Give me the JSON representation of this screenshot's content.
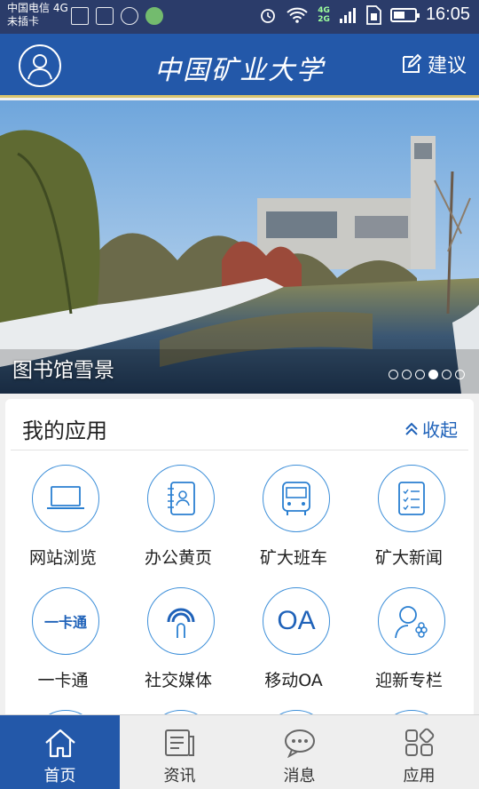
{
  "status_bar": {
    "carrier_line1": "中国电信 4G",
    "carrier_line2": "未插卡",
    "net_4g": "4G",
    "net_2g": "2G",
    "time": "16:05",
    "battery_level": 0.45
  },
  "header": {
    "logo_text": "中国矿业大学",
    "suggest_label": "建议"
  },
  "banner": {
    "caption": "图书馆雪景",
    "slide_count": 6,
    "active_slide": 4
  },
  "apps": {
    "title": "我的应用",
    "collapse_label": "收起",
    "items": [
      {
        "label": "网站浏览",
        "icon": "laptop-icon"
      },
      {
        "label": "办公黄页",
        "icon": "contact-book-icon"
      },
      {
        "label": "矿大班车",
        "icon": "bus-icon"
      },
      {
        "label": "矿大新闻",
        "icon": "news-list-icon"
      },
      {
        "label": "一卡通",
        "icon": "card-icon",
        "icon_text": "一卡通"
      },
      {
        "label": "社交媒体",
        "icon": "broadcast-icon"
      },
      {
        "label": "移动OA",
        "icon": "oa-icon",
        "icon_text": "OA"
      },
      {
        "label": "迎新专栏",
        "icon": "welcome-person-icon"
      }
    ]
  },
  "tabbar": {
    "tabs": [
      {
        "label": "首页",
        "icon": "home-icon",
        "active": true
      },
      {
        "label": "资讯",
        "icon": "news-icon",
        "active": false
      },
      {
        "label": "消息",
        "icon": "message-icon",
        "active": false
      },
      {
        "label": "应用",
        "icon": "apps-icon",
        "active": false
      }
    ]
  },
  "colors": {
    "header_bg": "#2358a9",
    "accent": "#1f62b9",
    "icon_stroke": "#3d8fd9"
  }
}
